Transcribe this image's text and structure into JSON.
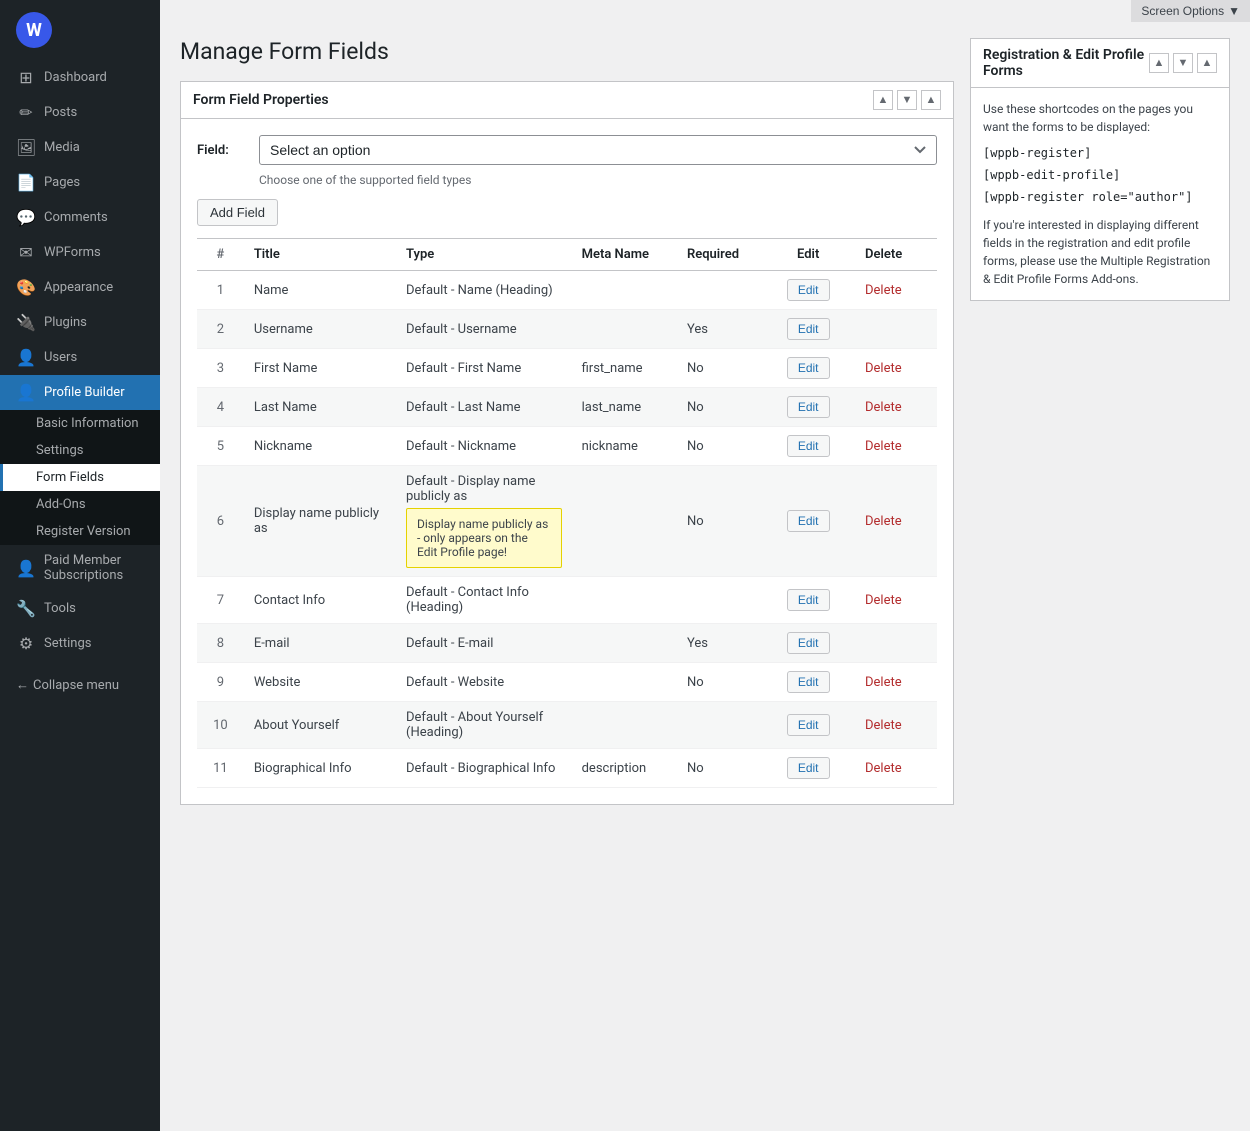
{
  "topbar": {
    "screen_options_label": "Screen Options"
  },
  "sidebar": {
    "items": [
      {
        "id": "dashboard",
        "label": "Dashboard",
        "icon": "⊞"
      },
      {
        "id": "posts",
        "label": "Posts",
        "icon": "✏"
      },
      {
        "id": "media",
        "label": "Media",
        "icon": "🖼"
      },
      {
        "id": "pages",
        "label": "Pages",
        "icon": "📄"
      },
      {
        "id": "comments",
        "label": "Comments",
        "icon": "💬"
      },
      {
        "id": "wpforms",
        "label": "WPForms",
        "icon": "✉"
      },
      {
        "id": "appearance",
        "label": "Appearance",
        "icon": "🎨"
      },
      {
        "id": "plugins",
        "label": "Plugins",
        "icon": "🔌"
      },
      {
        "id": "users",
        "label": "Users",
        "icon": "👤"
      },
      {
        "id": "profile-builder",
        "label": "Profile Builder",
        "icon": "👤"
      },
      {
        "id": "paid-member",
        "label": "Paid Member Subscriptions",
        "icon": "👤"
      },
      {
        "id": "tools",
        "label": "Tools",
        "icon": "🔧"
      },
      {
        "id": "settings",
        "label": "Settings",
        "icon": "⚙"
      }
    ],
    "profile_builder_submenu": [
      {
        "id": "basic-info",
        "label": "Basic Information"
      },
      {
        "id": "settings-sub",
        "label": "Settings"
      },
      {
        "id": "form-fields",
        "label": "Form Fields",
        "active": true
      },
      {
        "id": "add-ons",
        "label": "Add-Ons"
      },
      {
        "id": "register-version",
        "label": "Register Version"
      }
    ],
    "collapse_label": "Collapse menu"
  },
  "page": {
    "title": "Manage Form Fields"
  },
  "form_field_properties": {
    "title": "Form Field Properties",
    "field_label": "Field:",
    "select_placeholder": "Select an option",
    "select_hint": "Choose one of the supported field types",
    "add_field_label": "Add Field"
  },
  "table": {
    "headers": [
      "#",
      "Title",
      "Type",
      "Meta Name",
      "Required",
      "Edit",
      "Delete"
    ],
    "rows": [
      {
        "num": 1,
        "title": "Name",
        "type": "Default - Name (Heading)",
        "meta": "",
        "required": "",
        "has_delete": true
      },
      {
        "num": 2,
        "title": "Username",
        "type": "Default - Username",
        "meta": "",
        "required": "Yes",
        "has_delete": false
      },
      {
        "num": 3,
        "title": "First Name",
        "type": "Default - First Name",
        "meta": "first_name",
        "required": "No",
        "has_delete": true
      },
      {
        "num": 4,
        "title": "Last Name",
        "type": "Default - Last Name",
        "meta": "last_name",
        "required": "No",
        "has_delete": true
      },
      {
        "num": 5,
        "title": "Nickname",
        "type": "Default - Nickname",
        "meta": "nickname",
        "required": "No",
        "has_delete": true
      },
      {
        "num": 6,
        "title": "Display name publicly as",
        "type": "Default - Display name publicly as",
        "meta": "",
        "required": "No",
        "has_delete": true,
        "tooltip": "Display name publicly as - only appears on the Edit Profile page!"
      },
      {
        "num": 7,
        "title": "Contact Info",
        "type": "Default - Contact Info (Heading)",
        "meta": "",
        "required": "",
        "has_delete": true
      },
      {
        "num": 8,
        "title": "E-mail",
        "type": "Default - E-mail",
        "meta": "",
        "required": "Yes",
        "has_delete": false
      },
      {
        "num": 9,
        "title": "Website",
        "type": "Default - Website",
        "meta": "",
        "required": "No",
        "has_delete": true
      },
      {
        "num": 10,
        "title": "About Yourself",
        "type": "Default - About Yourself (Heading)",
        "meta": "",
        "required": "",
        "has_delete": true
      },
      {
        "num": 11,
        "title": "Biographical Info",
        "type": "Default - Biographical Info",
        "meta": "description",
        "required": "No",
        "has_delete": true
      }
    ],
    "edit_label": "Edit",
    "delete_label": "Delete"
  },
  "registration_box": {
    "title": "Registration & Edit Profile Forms",
    "intro": "Use these shortcodes on the pages you want the forms to be displayed:",
    "shortcodes": [
      "[wppb-register]",
      "[wppb-edit-profile]",
      "[wppb-register role=\"author\"]"
    ],
    "note": "If you're interested in displaying different fields in the registration and edit profile forms, please use the Multiple Registration & Edit Profile Forms Add-ons."
  }
}
